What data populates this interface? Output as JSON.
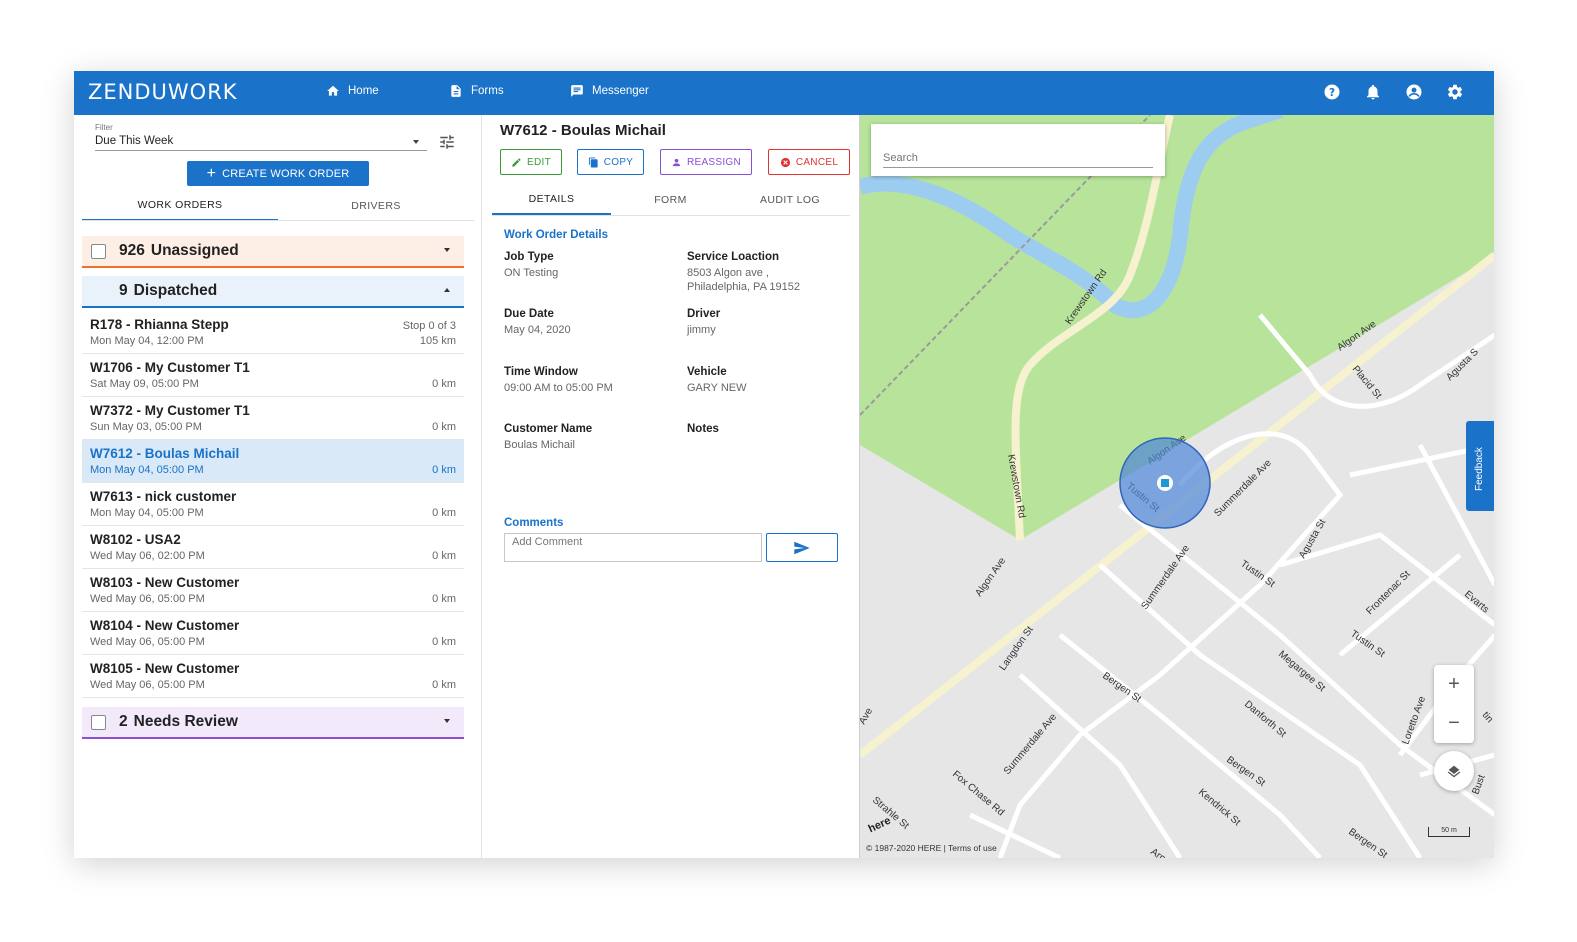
{
  "app": {
    "logo": "ZENDUWORK"
  },
  "nav": {
    "home": "Home",
    "forms": "Forms",
    "messenger": "Messenger"
  },
  "left": {
    "filter_label": "Filter",
    "filter_value": "Due This Week",
    "create_label": "CREATE WORK ORDER",
    "tabs": [
      "WORK ORDERS",
      "DRIVERS"
    ],
    "groups": {
      "unassigned": {
        "count": "926",
        "name": "Unassigned"
      },
      "dispatched": {
        "count": "9",
        "name": "Dispatched"
      },
      "review": {
        "count": "2",
        "name": "Needs Review"
      }
    },
    "orders": [
      {
        "title": "R178 - Rhianna Stepp",
        "date": "Mon May 04, 12:00 PM",
        "stop": "Stop 0 of 3",
        "dist": "105 km"
      },
      {
        "title": "W1706 - My Customer T1",
        "date": "Sat May 09, 05:00 PM",
        "stop": "",
        "dist": "0 km"
      },
      {
        "title": "W7372 - My Customer T1",
        "date": "Sun May 03, 05:00 PM",
        "stop": "",
        "dist": "0 km"
      },
      {
        "title": "W7612 - Boulas Michail",
        "date": "Mon May 04, 05:00 PM",
        "stop": "",
        "dist": "0 km"
      },
      {
        "title": "W7613 - nick customer",
        "date": "Mon May 04, 05:00 PM",
        "stop": "",
        "dist": "0 km"
      },
      {
        "title": "W8102 - USA2",
        "date": "Wed May 06, 02:00 PM",
        "stop": "",
        "dist": "0 km"
      },
      {
        "title": "W8103 - New Customer",
        "date": "Wed May 06, 05:00 PM",
        "stop": "",
        "dist": "0 km"
      },
      {
        "title": "W8104 - New Customer",
        "date": "Wed May 06, 05:00 PM",
        "stop": "",
        "dist": "0 km"
      },
      {
        "title": "W8105 - New Customer",
        "date": "Wed May 06, 05:00 PM",
        "stop": "",
        "dist": "0 km"
      }
    ]
  },
  "detail": {
    "title": "W7612 - Boulas Michail",
    "actions": {
      "edit": "EDIT",
      "copy": "COPY",
      "reassign": "REASSIGN",
      "cancel": "CANCEL"
    },
    "tabs": [
      "DETAILS",
      "FORM",
      "AUDIT LOG"
    ],
    "section_title": "Work Order Details",
    "fields": {
      "job_type": {
        "label": "Job Type",
        "value": "ON Testing"
      },
      "service_location": {
        "label": "Service Loaction",
        "value": "8503 Algon ave ,",
        "value2": "Philadelphia, PA 19152"
      },
      "due_date": {
        "label": "Due Date",
        "value": "May 04, 2020"
      },
      "driver": {
        "label": "Driver",
        "value": "jimmy"
      },
      "time_window": {
        "label": "Time Window",
        "value": "09:00 AM to 05:00 PM"
      },
      "vehicle": {
        "label": "Vehicle",
        "value": "GARY NEW"
      },
      "customer_name": {
        "label": "Customer Name",
        "value": "Boulas Michail"
      },
      "notes": {
        "label": "Notes",
        "value": ""
      }
    },
    "comments_label": "Comments",
    "comment_placeholder": "Add Comment"
  },
  "map": {
    "search_placeholder": "Search",
    "feedback": "Feedback",
    "copyright": "© 1987-2020 HERE | Terms of use",
    "here": "here",
    "scale": "50 m",
    "streets": {
      "krewstown_rd": "Krewstown Rd",
      "algon_ave": "Algon Ave",
      "tustin_st": "Tustin St",
      "summerdale_ave": "Summerdale Ave",
      "agusta_st": "Agusta St",
      "placid_st": "Placid St",
      "langdon_st": "Langdon St",
      "bergen_st": "Bergen St",
      "megargee_st": "Megargee St",
      "danforth_st": "Danforth St",
      "frontenac_st": "Frontenac St",
      "evarts": "Evarts",
      "fox_chase_rd": "Fox Chase Rd",
      "kendrick_st": "Kendrick St",
      "strahle_st": "Strahle St",
      "loretto_ave": "Loretto Ave",
      "ave": "Ave",
      "arno": "Arno",
      "bust": "Bust",
      "tin": "tin",
      "agusta_s": "Agusta S"
    }
  },
  "colors": {
    "primary": "#1a72c9",
    "unassigned": "#f0702a",
    "review": "#8a4fd6",
    "edit": "#3c9a3c",
    "copy": "#1a72c9",
    "reassign": "#8a4fd6",
    "cancel": "#e03434",
    "park": "#b7e49a",
    "water": "#9ccdf0"
  }
}
